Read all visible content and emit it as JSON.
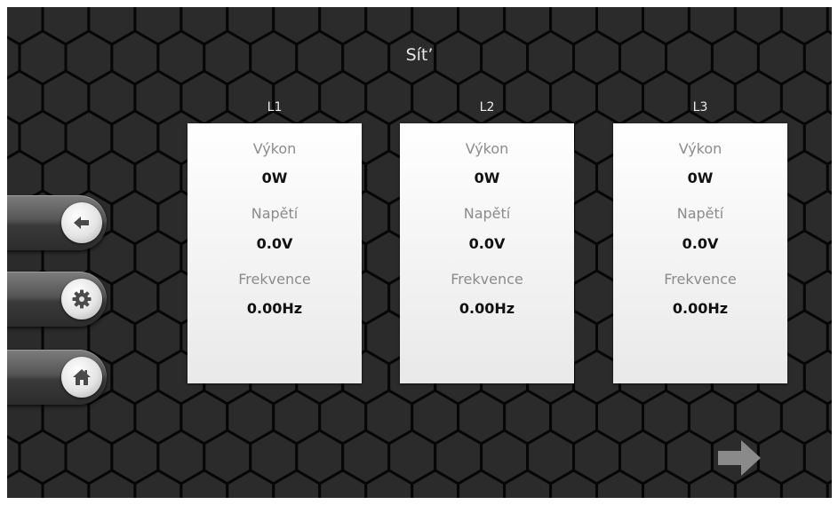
{
  "header": {
    "title": "Sít’"
  },
  "phases": [
    {
      "label": "L1",
      "power_label": "Výkon",
      "power_value": "0W",
      "voltage_label": "Napětí",
      "voltage_value": "0.0V",
      "frequency_label": "Frekvence",
      "frequency_value": "0.00Hz"
    },
    {
      "label": "L2",
      "power_label": "Výkon",
      "power_value": "0W",
      "voltage_label": "Napětí",
      "voltage_value": "0.0V",
      "frequency_label": "Frekvence",
      "frequency_value": "0.00Hz"
    },
    {
      "label": "L3",
      "power_label": "Výkon",
      "power_value": "0W",
      "voltage_label": "Napětí",
      "voltage_value": "0.0V",
      "frequency_label": "Frekvence",
      "frequency_value": "0.00Hz"
    }
  ],
  "sidebar": {
    "buttons": [
      {
        "icon": "back-arrow-icon"
      },
      {
        "icon": "gear-icon"
      },
      {
        "icon": "home-icon"
      }
    ]
  },
  "footer": {
    "next_icon": "right-arrow-icon"
  },
  "colors": {
    "background": "#1c1c1c",
    "hex_stroke": "#000000",
    "card": "#f2f2f2",
    "label_text": "#8b8b8b",
    "value_text": "#111111",
    "button_icon": "#4a4a4a",
    "next_arrow": "#8a8a8a"
  }
}
